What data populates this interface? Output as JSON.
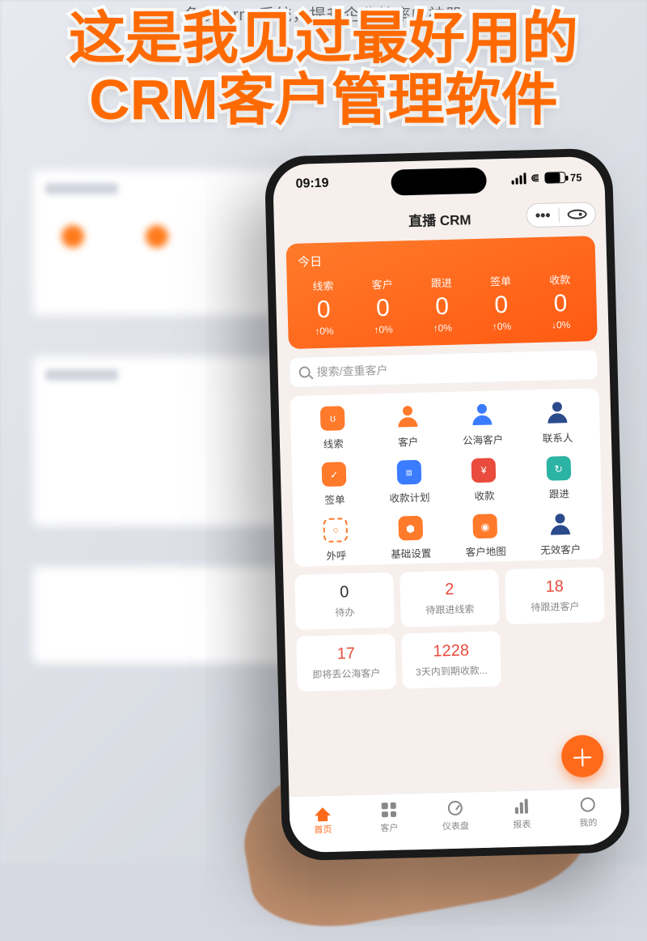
{
  "top_caption": "免费 crm 系统，提升企业效率的神器",
  "headline_line1": "这是我见过最好用的",
  "headline_line2": "CRM客户管理软件",
  "phone": {
    "status": {
      "time": "09:19",
      "battery_pct": "75"
    },
    "header": {
      "title": "直播 CRM"
    },
    "today": {
      "title": "今日",
      "cols": [
        {
          "label": "线索",
          "value": "0",
          "pct": "↑0%"
        },
        {
          "label": "客户",
          "value": "0",
          "pct": "↑0%"
        },
        {
          "label": "跟进",
          "value": "0",
          "pct": "↑0%"
        },
        {
          "label": "签单",
          "value": "0",
          "pct": "↑0%"
        },
        {
          "label": "收款",
          "value": "0",
          "pct": "↓0%"
        }
      ]
    },
    "search": {
      "placeholder": "搜索/查重客户"
    },
    "grid": [
      {
        "label": "线索",
        "icon": "ic-orange",
        "glyph": "ʊ"
      },
      {
        "label": "客户",
        "icon": "person p-orange",
        "glyph": ""
      },
      {
        "label": "公海客户",
        "icon": "person p-blue",
        "glyph": ""
      },
      {
        "label": "联系人",
        "icon": "person p-dark",
        "glyph": ""
      },
      {
        "label": "签单",
        "icon": "ic-orange",
        "glyph": "✓"
      },
      {
        "label": "收款计划",
        "icon": "ic-blue",
        "glyph": "⧈"
      },
      {
        "label": "收款",
        "icon": "ic-red",
        "glyph": "¥"
      },
      {
        "label": "跟进",
        "icon": "ic-teal",
        "glyph": "↻"
      },
      {
        "label": "外呼",
        "icon": "ic-outline",
        "glyph": "○"
      },
      {
        "label": "基础设置",
        "icon": "ic-orange",
        "glyph": "⬢"
      },
      {
        "label": "客户地图",
        "icon": "ic-orange",
        "glyph": "◉"
      },
      {
        "label": "无效客户",
        "icon": "person p-dark",
        "glyph": ""
      }
    ],
    "tiles": [
      {
        "num": "0",
        "label": "待办",
        "red": false
      },
      {
        "num": "2",
        "label": "待跟进线索",
        "red": true
      },
      {
        "num": "18",
        "label": "待跟进客户",
        "red": true
      },
      {
        "num": "17",
        "label": "即将丢公海客户",
        "red": true
      },
      {
        "num": "1228",
        "label": "3天内到期收款...",
        "red": true
      }
    ],
    "nav": [
      {
        "label": "首页",
        "icon": "home",
        "active": true
      },
      {
        "label": "客户",
        "icon": "grid4",
        "active": false
      },
      {
        "label": "仪表盘",
        "icon": "gauge",
        "active": false
      },
      {
        "label": "报表",
        "icon": "bars",
        "active": false
      },
      {
        "label": "我的",
        "icon": "face",
        "active": false
      }
    ]
  }
}
